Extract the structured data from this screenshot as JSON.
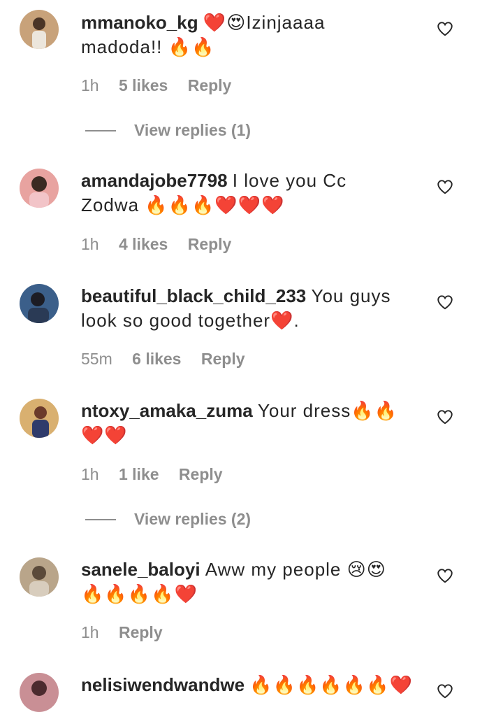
{
  "comments": [
    {
      "username": "mmanoko_kg",
      "text": "❤️😍Izinjaaaa madoda!! 🔥🔥",
      "time": "1h",
      "likes": "5 likes",
      "reply_label": "Reply",
      "view_replies": "View replies (1)",
      "avatar_colors": [
        "#c8a27a",
        "#4a3426"
      ]
    },
    {
      "username": "amandajobe7798",
      "text": "I love you Cc Zodwa 🔥🔥🔥❤️❤️❤️",
      "time": "1h",
      "likes": "4 likes",
      "reply_label": "Reply",
      "avatar_colors": [
        "#e8a3a0",
        "#3a2a22"
      ]
    },
    {
      "username": "beautiful_black_child_233",
      "text": "You guys look so good together❤️.",
      "time": "55m",
      "likes": "6 likes",
      "reply_label": "Reply",
      "avatar_colors": [
        "#3b5f8a",
        "#1c1c24"
      ]
    },
    {
      "username": "ntoxy_amaka_zuma",
      "text": "Your dress🔥🔥❤️❤️",
      "time": "1h",
      "likes": "1 like",
      "reply_label": "Reply",
      "view_replies": "View replies (2)",
      "avatar_colors": [
        "#d9b070",
        "#6b3a2a"
      ]
    },
    {
      "username": "sanele_baloyi",
      "text": "Aww my people 😢😍🔥🔥🔥🔥❤️",
      "time": "1h",
      "likes": "",
      "reply_label": "Reply",
      "avatar_colors": [
        "#b9a58a",
        "#5b4a3a"
      ]
    },
    {
      "username": "nelisiwendwandwe",
      "text": "🔥🔥🔥🔥🔥🔥❤️",
      "avatar_colors": [
        "#c98f95",
        "#4b2b2e"
      ]
    }
  ],
  "icons": {
    "like": "heart-outline-icon"
  },
  "colors": {
    "text": "#262626",
    "meta": "#8e8e8e",
    "background": "#ffffff"
  }
}
